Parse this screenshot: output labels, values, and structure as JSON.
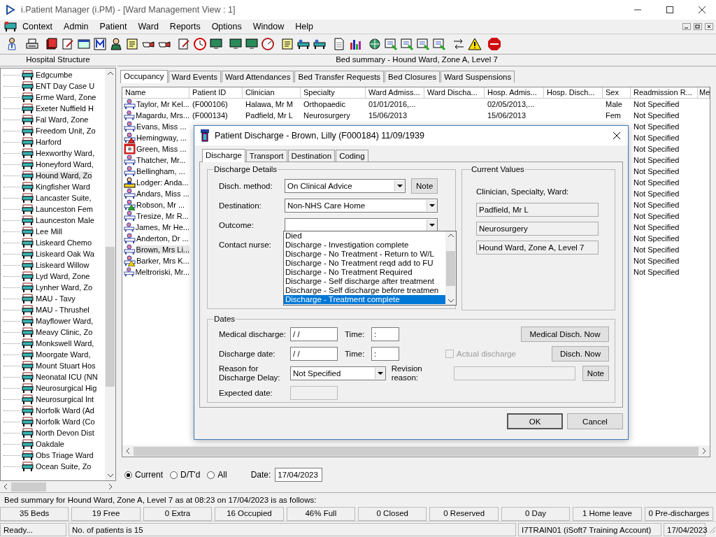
{
  "window": {
    "title": "i.Patient Manager (i.PM) - [Ward Management View : 1]"
  },
  "menu": [
    "Context",
    "Admin",
    "Patient",
    "Ward",
    "Reports",
    "Options",
    "Window",
    "Help"
  ],
  "left_panel": {
    "title": "Hospital Structure",
    "items": [
      {
        "label": "Edgcumbe",
        "selected": false
      },
      {
        "label": "ENT Day Case U",
        "selected": false
      },
      {
        "label": "Erme Ward, Zone",
        "selected": false
      },
      {
        "label": "Exeter Nuffield H",
        "selected": false
      },
      {
        "label": "Fal Ward, Zone",
        "selected": false
      },
      {
        "label": "Freedom Unit, Zo",
        "selected": false
      },
      {
        "label": "Harford",
        "selected": false
      },
      {
        "label": "Hexworthy Ward,",
        "selected": false
      },
      {
        "label": "Honeyford Ward,",
        "selected": false
      },
      {
        "label": "Hound Ward, Zo",
        "selected": true
      },
      {
        "label": "Kingfisher Ward",
        "selected": false
      },
      {
        "label": "Lancaster Suite,",
        "selected": false
      },
      {
        "label": "Launceston Fem",
        "selected": false
      },
      {
        "label": "Launceston Male",
        "selected": false
      },
      {
        "label": "Lee Mill",
        "selected": false
      },
      {
        "label": "Liskeard Chemo",
        "selected": false
      },
      {
        "label": "Liskeard Oak Wa",
        "selected": false
      },
      {
        "label": "Liskeard Willow",
        "selected": false
      },
      {
        "label": "Lyd Ward, Zone",
        "selected": false
      },
      {
        "label": "Lynher Ward, Zo",
        "selected": false
      },
      {
        "label": "MAU - Tavy",
        "selected": false
      },
      {
        "label": "MAU - Thrushel",
        "selected": false
      },
      {
        "label": "Mayflower Ward,",
        "selected": false
      },
      {
        "label": "Meavy Clinic, Zo",
        "selected": false
      },
      {
        "label": "Monkswell Ward,",
        "selected": false
      },
      {
        "label": "Moorgate Ward,",
        "selected": false
      },
      {
        "label": "Mount Stuart Hos",
        "selected": false
      },
      {
        "label": "Neonatal ICU (NN",
        "selected": false
      },
      {
        "label": "Neurosurgical Hig",
        "selected": false
      },
      {
        "label": "Neurosurgical Int",
        "selected": false
      },
      {
        "label": "Norfolk Ward (Ad",
        "selected": false
      },
      {
        "label": "Norfolk Ward (Co",
        "selected": false
      },
      {
        "label": "North Devon Dist",
        "selected": false
      },
      {
        "label": "Oakdale",
        "selected": false
      },
      {
        "label": "Obs Triage Ward",
        "selected": false
      },
      {
        "label": "Ocean Suite, Zo",
        "selected": false
      }
    ]
  },
  "right_panel": {
    "title": "Bed summary - Hound Ward, Zone A, Level 7",
    "tabs": [
      {
        "label": "Occupancy",
        "selected": true
      },
      {
        "label": "Ward Events",
        "selected": false
      },
      {
        "label": "Ward Attendances",
        "selected": false
      },
      {
        "label": "Bed Transfer Requests",
        "selected": false
      },
      {
        "label": "Bed Closures",
        "selected": false
      },
      {
        "label": "Ward Suspensions",
        "selected": false
      }
    ],
    "table": {
      "columns": [
        "Name",
        "Patient ID",
        "Clinician",
        "Specialty",
        "Ward Admiss...",
        "Ward Discha...",
        "Hosp. Admis...",
        "Hosp. Disch...",
        "Sex",
        "Readmission R...",
        "Me"
      ],
      "rows": [
        {
          "kind": "standard",
          "selected": false,
          "name": "Taylor, Mr Kel...",
          "patient_id": "(F000106)",
          "clinician": "Halawa, Mr M",
          "specialty": "Orthopaedic",
          "ward_admission": "01/01/2016,...",
          "hosp_admission": "02/05/2013,...",
          "sex": "Male",
          "readmission": "Not Specified"
        },
        {
          "kind": "standard",
          "selected": false,
          "name": "Magardu, Mrs...",
          "patient_id": "(F000134)",
          "clinician": "Padfield, Mr L",
          "specialty": "Neurosurgery",
          "ward_admission": "15/06/2013",
          "hosp_admission": "15/06/2013",
          "sex": "Fem",
          "readmission": "Not Specified"
        },
        {
          "kind": "standard",
          "selected": false,
          "name": "Evans, Miss ...",
          "readmission": "Not Specified"
        },
        {
          "kind": "alert-red",
          "selected": false,
          "name": "Hemingway, ...",
          "readmission": "Not Specified"
        },
        {
          "kind": "blocked",
          "selected": false,
          "name": "Green, Miss ...",
          "readmission": "Not Specified"
        },
        {
          "kind": "standard",
          "selected": false,
          "name": "Thatcher, Mr...",
          "readmission": "Not Specified"
        },
        {
          "kind": "standard",
          "selected": false,
          "name": "Bellingham, ...",
          "readmission": "Not Specified"
        },
        {
          "kind": "lodger",
          "selected": false,
          "name": "Lodger: Anda...",
          "readmission": "Not Specified"
        },
        {
          "kind": "standard",
          "selected": false,
          "name": "Andars, Miss ...",
          "readmission": "Not Specified"
        },
        {
          "kind": "alert-green",
          "selected": false,
          "name": "Robson, Mr ...",
          "readmission": "Not Specified"
        },
        {
          "kind": "standard",
          "selected": false,
          "name": "Tresize, Mr R...",
          "readmission": "Not Specified"
        },
        {
          "kind": "standard",
          "selected": false,
          "name": "James, Mr He...",
          "readmission": "Not Specified"
        },
        {
          "kind": "standard",
          "selected": false,
          "name": "Anderton, Dr ...",
          "readmission": "Not Specified"
        },
        {
          "kind": "standard",
          "selected": true,
          "name": "Brown, Mrs Li...",
          "readmission": "Not Specified"
        },
        {
          "kind": "alert-yellow",
          "selected": false,
          "name": "Barker, Mrs K...",
          "readmission": "Not Specified"
        },
        {
          "kind": "standard",
          "selected": false,
          "name": "Meltroriski, Mr...",
          "readmission": "Not Specified"
        }
      ]
    },
    "filters": [
      {
        "label": "Current",
        "selected": true
      },
      {
        "label": "D/T'd",
        "selected": false
      },
      {
        "label": "All",
        "selected": false
      }
    ],
    "date": {
      "label": "Date:",
      "value": "17/04/2023"
    }
  },
  "dialog": {
    "title": "Patient Discharge - Brown, Lilly (F000184) 11/09/1939",
    "tabs": [
      {
        "label": "Discharge",
        "selected": true
      },
      {
        "label": "Transport",
        "selected": false
      },
      {
        "label": "Destination",
        "selected": false
      },
      {
        "label": "Coding",
        "selected": false
      }
    ],
    "details": {
      "title": "Discharge Details",
      "method_label": "Disch. method:",
      "method_value": "On Clinical Advice",
      "note_button": "Note",
      "destination_label": "Destination:",
      "destination_value": "Non-NHS Care Home",
      "outcome_label": "Outcome:",
      "nurse_label": "Contact nurse:",
      "outcome_options": [
        {
          "label": "Died",
          "selected": false
        },
        {
          "label": "Discharge - Investigation complete",
          "selected": false
        },
        {
          "label": "Discharge - No Treatment - Return to W/L",
          "selected": false
        },
        {
          "label": "Discharge - No Treatment reqd add to FU",
          "selected": false
        },
        {
          "label": "Discharge - No Treatment Required",
          "selected": false
        },
        {
          "label": "Discharge - Self discharge after treatment",
          "selected": false
        },
        {
          "label": "Discharge - Self discharge before treatmen",
          "selected": false
        },
        {
          "label": "Discharge - Treatment complete",
          "selected": true
        }
      ]
    },
    "current_values": {
      "title": "Current Values",
      "label": "Clinician, Specialty, Ward:",
      "values": [
        "Padfield, Mr L",
        "Neurosurgery",
        "Hound Ward, Zone A, Level 7"
      ]
    },
    "dates": {
      "title": "Dates",
      "medical_label": "Medical discharge:",
      "medical_value": "/ /",
      "time_label_1": "Time:",
      "medical_time": ":",
      "medical_now_button": "Medical Disch. Now",
      "discharge_label": "Discharge date:",
      "discharge_value": "/ /",
      "time_label_2": "Time:",
      "discharge_time": ":",
      "actual_label": "Actual discharge",
      "actual_checked": false,
      "actual_disabled": true,
      "disch_now_button": "Disch. Now",
      "delay_label": "Reason for Discharge Delay:",
      "delay_value": "Not Specified",
      "revision_label": "Revision reason:",
      "note_button": "Note",
      "expected_label": "Expected date:"
    },
    "buttons": [
      "OK",
      "Cancel"
    ]
  },
  "summary": "Bed summary for Hound Ward, Zone A, Level 7 as at 08:23 on 17/04/2023 is as follows:",
  "stats": [
    "35 Beds",
    "19 Free",
    "0 Extra",
    "16 Occupied",
    "46% Full",
    "0 Closed",
    "0 Reserved",
    "0 Day",
    "1 Home leave",
    "0 Pre-discharges"
  ],
  "status_bar": [
    "Ready...",
    "No. of patients is 15",
    "I7TRAIN01 (iSoft7 Training Account)",
    "17/04/2023"
  ]
}
